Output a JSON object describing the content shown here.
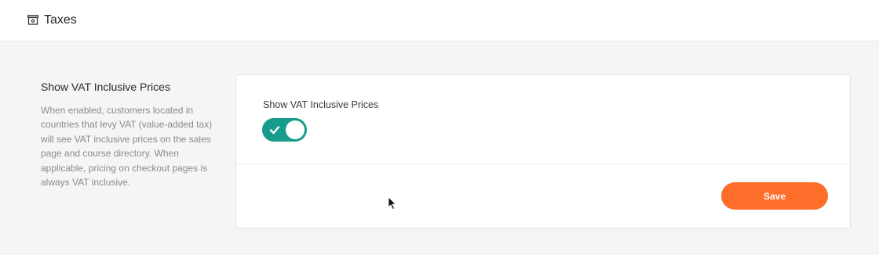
{
  "header": {
    "icon": "banknote-icon",
    "title": "Taxes"
  },
  "section": {
    "title": "Show VAT Inclusive Prices",
    "description": "When enabled, customers located in countries that levy VAT (value-added tax) will see VAT inclusive prices on the sales page and course directory. When applicable, pricing on checkout pages is always VAT inclusive."
  },
  "card": {
    "field_label": "Show VAT Inclusive Prices",
    "toggle": {
      "checked": true,
      "icon": "check-icon",
      "color": "#169b8c"
    },
    "save_label": "Save",
    "save_color": "#ff6d2a"
  }
}
